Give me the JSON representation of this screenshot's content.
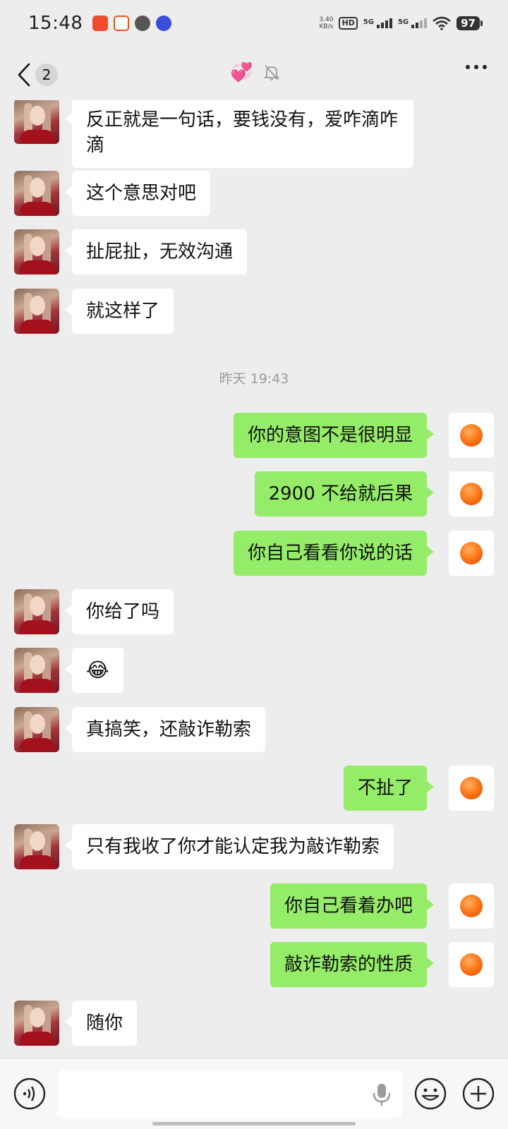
{
  "status_bar": {
    "time": "15:48",
    "net_speed_value": "3.40",
    "net_speed_unit": "KB/s",
    "hd_label": "HD",
    "sim1_label": "5G",
    "sim2_label": "5G",
    "battery": "97"
  },
  "header": {
    "unread_count": "2",
    "contact_name_emoji": "💞"
  },
  "messages": [
    {
      "side": "left",
      "text": "反正就是一句话，要钱没有，爱咋滴咋滴"
    },
    {
      "side": "left",
      "text": "这个意思对吧"
    },
    {
      "side": "left",
      "text": "扯屁扯，无效沟通"
    },
    {
      "side": "left",
      "text": "就这样了"
    },
    {
      "type": "time",
      "text": "昨天 19:43"
    },
    {
      "side": "right",
      "text": "你的意图不是很明显"
    },
    {
      "side": "right",
      "text": "2900 不给就后果"
    },
    {
      "side": "right",
      "text": "你自己看看你说的话"
    },
    {
      "side": "left",
      "text": "你给了吗"
    },
    {
      "side": "left",
      "text": "😂"
    },
    {
      "side": "left",
      "text": "真搞笑，还敲诈勒索"
    },
    {
      "side": "right",
      "text": "不扯了"
    },
    {
      "side": "left",
      "text": "只有我收了你才能认定我为敲诈勒索"
    },
    {
      "side": "right",
      "text": "你自己看着办吧"
    },
    {
      "side": "right",
      "text": "敲诈勒索的性质"
    },
    {
      "side": "left",
      "text": "随你"
    }
  ],
  "input": {
    "value": "",
    "placeholder": ""
  },
  "colors": {
    "background": "#ededed",
    "bubble_self": "#95ec69",
    "bubble_other": "#ffffff"
  }
}
